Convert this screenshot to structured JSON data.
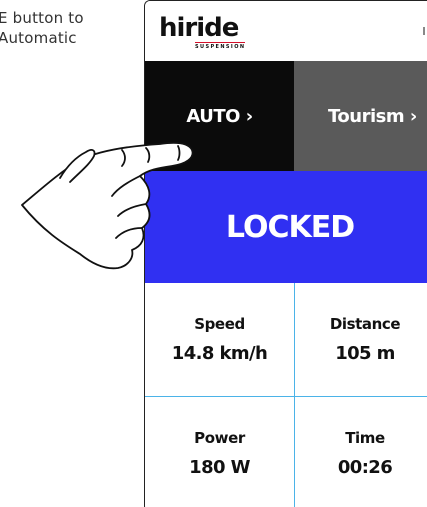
{
  "caption": {
    "line1": "E button to",
    "line2": "Automatic"
  },
  "app": {
    "logo_text": "hiride",
    "logo_subtext": "SUSPENSION",
    "battery_icon": "battery-icon"
  },
  "tabs": [
    {
      "label": "AUTO ›",
      "color": "#0b0b0b"
    },
    {
      "label": "Tourism ›",
      "color": "#5a5a5a"
    }
  ],
  "status": {
    "label": "LOCKED",
    "color": "#3030f2"
  },
  "stats": [
    {
      "label": "Speed",
      "value": "14.8 km/h"
    },
    {
      "label": "Distance",
      "value": "105 m"
    },
    {
      "label": "Power",
      "value": "180 W"
    },
    {
      "label": "Time",
      "value": "00:26"
    }
  ],
  "colors": {
    "grid_lines": "#4bb3e8",
    "logo_accent": "#d3102a"
  },
  "overlay": {
    "icon": "pointing-hand-icon"
  }
}
